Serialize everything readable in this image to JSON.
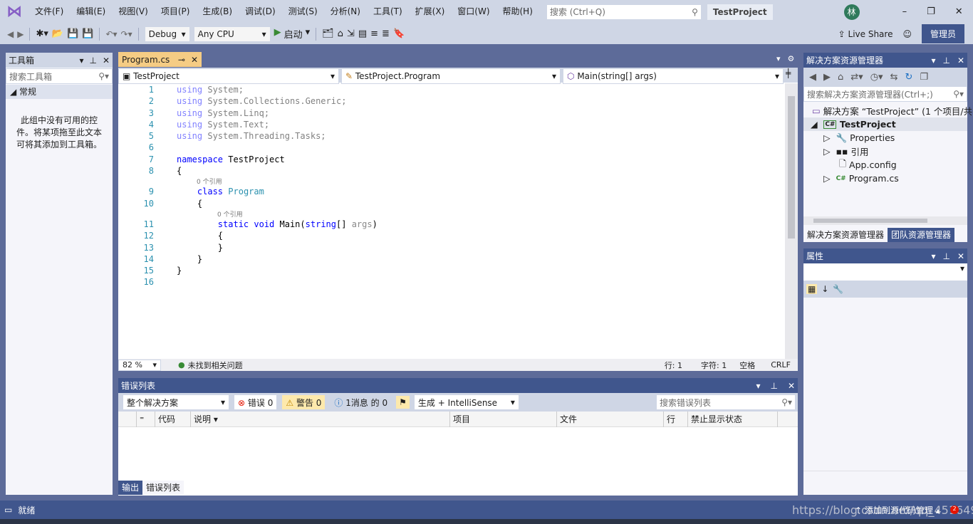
{
  "menu": [
    "文件(F)",
    "编辑(E)",
    "视图(V)",
    "项目(P)",
    "生成(B)",
    "调试(D)",
    "测试(S)",
    "分析(N)",
    "工具(T)",
    "扩展(X)",
    "窗口(W)",
    "帮助(H)"
  ],
  "search": {
    "placeholder": "搜索 (Ctrl+Q)"
  },
  "project_title": "TestProject",
  "avatar": "林",
  "toolbar": {
    "config": "Debug",
    "platform": "Any CPU",
    "start": "启动",
    "live_share": "Live Share",
    "admin": "管理员"
  },
  "toolbox": {
    "title": "工具箱",
    "search_placeholder": "搜索工具箱",
    "group": "常规",
    "empty_text": "此组中没有可用的控件。将某项拖至此文本可将其添加到工具箱。"
  },
  "editor": {
    "tab": "Program.cs",
    "nav": [
      "TestProject",
      "TestProject.Program",
      "Main(string[] args)"
    ],
    "zoom": "82 %",
    "issues": "未找到相关问题",
    "line": "行: 1",
    "char": "字符: 1",
    "spaces": "空格",
    "eol": "CRLF",
    "code": [
      {
        "n": "1",
        "t": [
          [
            "kw dim",
            "using"
          ],
          [
            "pl dim",
            " System;"
          ]
        ]
      },
      {
        "n": "2",
        "t": [
          [
            "kw dim",
            "using"
          ],
          [
            "pl dim",
            " System.Collections.Generic;"
          ]
        ]
      },
      {
        "n": "3",
        "t": [
          [
            "kw dim",
            "using"
          ],
          [
            "pl dim",
            " System.Linq;"
          ]
        ]
      },
      {
        "n": "4",
        "t": [
          [
            "kw dim",
            "using"
          ],
          [
            "pl dim",
            " System.Text;"
          ]
        ]
      },
      {
        "n": "5",
        "t": [
          [
            "kw dim",
            "using"
          ],
          [
            "pl dim",
            " System.Threading.Tasks;"
          ]
        ]
      },
      {
        "n": "6",
        "t": []
      },
      {
        "n": "7",
        "t": [
          [
            "kw",
            "namespace"
          ],
          [
            "pl",
            " TestProject"
          ]
        ]
      },
      {
        "n": "8",
        "t": [
          [
            "pl",
            "{"
          ]
        ],
        "ref": "0 个引用"
      },
      {
        "n": "9",
        "t": [
          [
            "pl",
            "    "
          ],
          [
            "kw",
            "class"
          ],
          [
            "pl",
            " "
          ],
          [
            "ty",
            "Program"
          ]
        ]
      },
      {
        "n": "10",
        "t": [
          [
            "pl",
            "    {"
          ]
        ],
        "ref": "0 个引用"
      },
      {
        "n": "11",
        "t": [
          [
            "pl",
            "        "
          ],
          [
            "kw",
            "static void"
          ],
          [
            "pl",
            " Main("
          ],
          [
            "kw",
            "string"
          ],
          [
            "pl",
            "[] "
          ],
          [
            "gray",
            "args"
          ],
          [
            "pl",
            ")"
          ]
        ]
      },
      {
        "n": "12",
        "t": [
          [
            "pl",
            "        {"
          ]
        ]
      },
      {
        "n": "13",
        "t": [
          [
            "pl",
            "        }"
          ]
        ]
      },
      {
        "n": "14",
        "t": [
          [
            "pl",
            "    }"
          ]
        ]
      },
      {
        "n": "15",
        "t": [
          [
            "pl",
            "}"
          ]
        ]
      },
      {
        "n": "16",
        "t": []
      }
    ]
  },
  "error_list": {
    "title": "错误列表",
    "scope": "整个解决方案",
    "errors": "错误 0",
    "warnings": "警告 0",
    "messages": "1消息 的 0",
    "build": "生成 + IntelliSense",
    "search_placeholder": "搜索错误列表",
    "columns": [
      "代码",
      "说明",
      "项目",
      "文件",
      "行",
      "禁止显示状态"
    ],
    "tabs": [
      "输出",
      "错误列表"
    ]
  },
  "solution": {
    "title": "解决方案资源管理器",
    "search_placeholder": "搜索解决方案资源管理器(Ctrl+;)",
    "root": "解决方案 “TestProject” (1 个项目/共",
    "project": "TestProject",
    "items": [
      "Properties",
      "引用",
      "App.config",
      "Program.cs"
    ],
    "tabs": [
      "解决方案资源管理器",
      "团队资源管理器"
    ]
  },
  "properties": {
    "title": "属性"
  },
  "status": {
    "ready": "就绪",
    "source_control": "添加到源代码管理",
    "watermark": "https://blog.csdn.net/qq_45164916"
  }
}
